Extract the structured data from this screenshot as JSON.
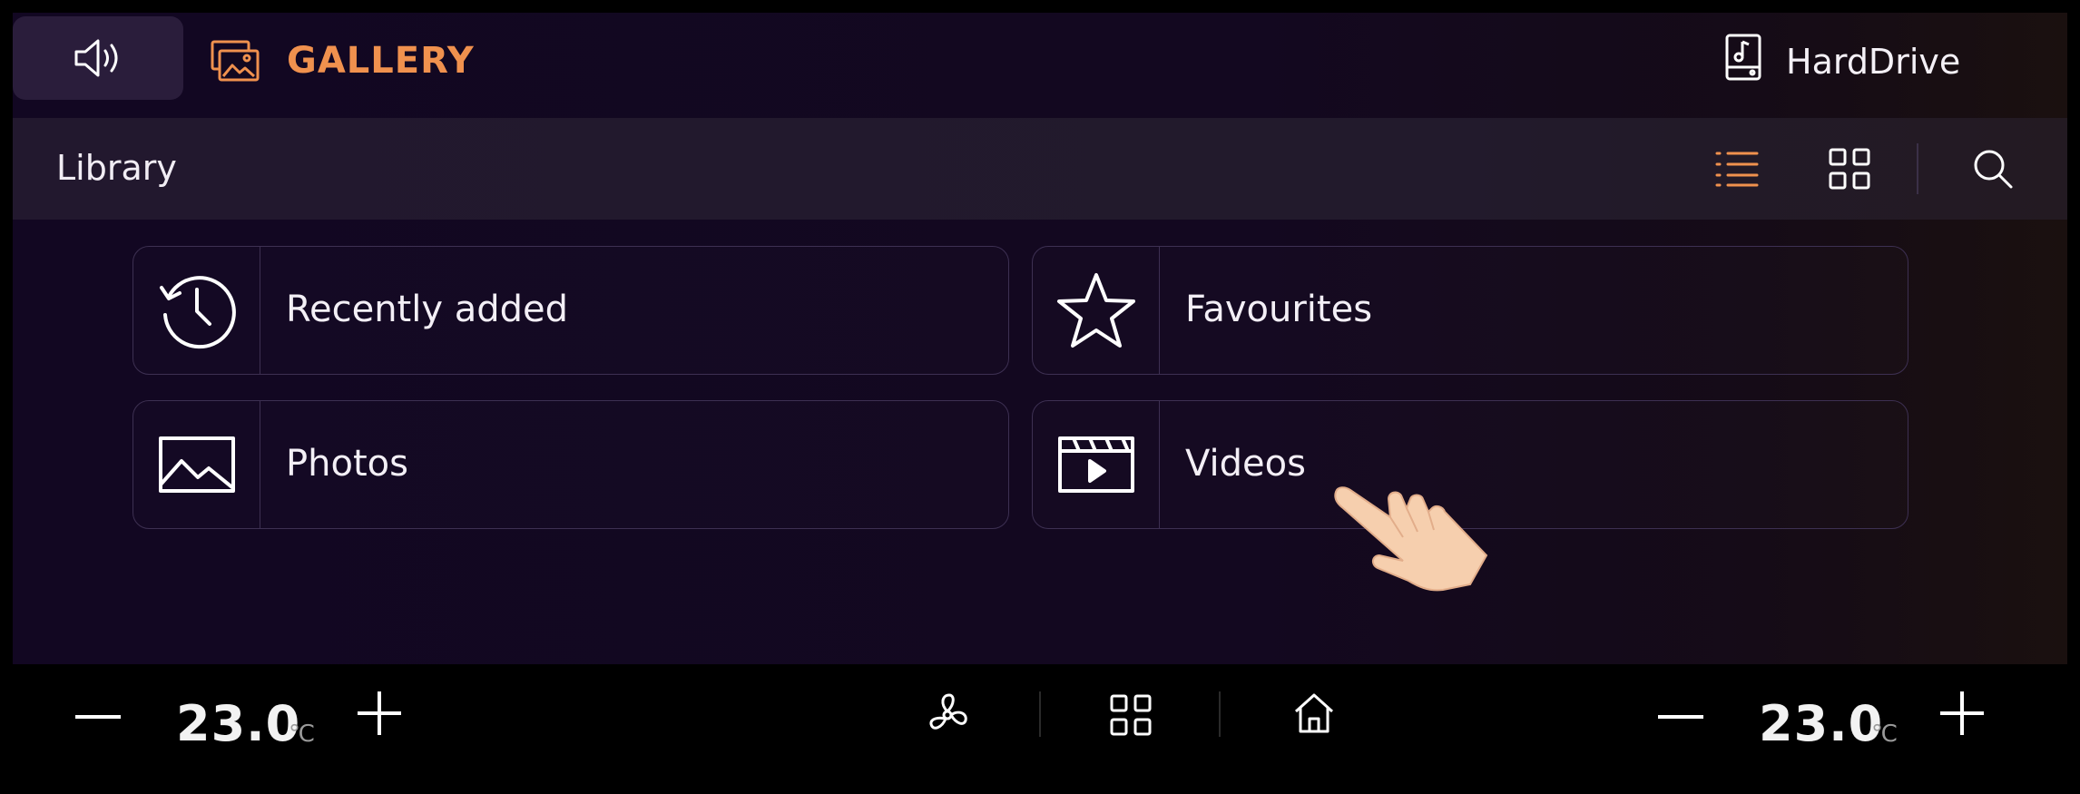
{
  "app": {
    "title": "GALLERY",
    "source_label": "HardDrive",
    "accent_color": "#f0914e"
  },
  "topbar": {
    "volume_icon": "speaker-icon",
    "gallery_icon": "gallery-icon",
    "source_icon": "music-drive-icon"
  },
  "subbar": {
    "title": "Library",
    "list_view_icon": "list-icon",
    "grid_view_icon": "grid-icon",
    "search_icon": "search-icon",
    "active_view": "list"
  },
  "library": {
    "items": [
      {
        "label": "Recently added",
        "icon": "history-icon"
      },
      {
        "label": "Favourites",
        "icon": "star-icon"
      },
      {
        "label": "Photos",
        "icon": "image-icon"
      },
      {
        "label": "Videos",
        "icon": "video-icon"
      }
    ]
  },
  "climate": {
    "left_temp": "23.0",
    "right_temp": "23.0",
    "unit": "℃"
  },
  "dock": {
    "fan_icon": "fan-icon",
    "apps_icon": "apps-grid-icon",
    "home_icon": "home-icon"
  }
}
